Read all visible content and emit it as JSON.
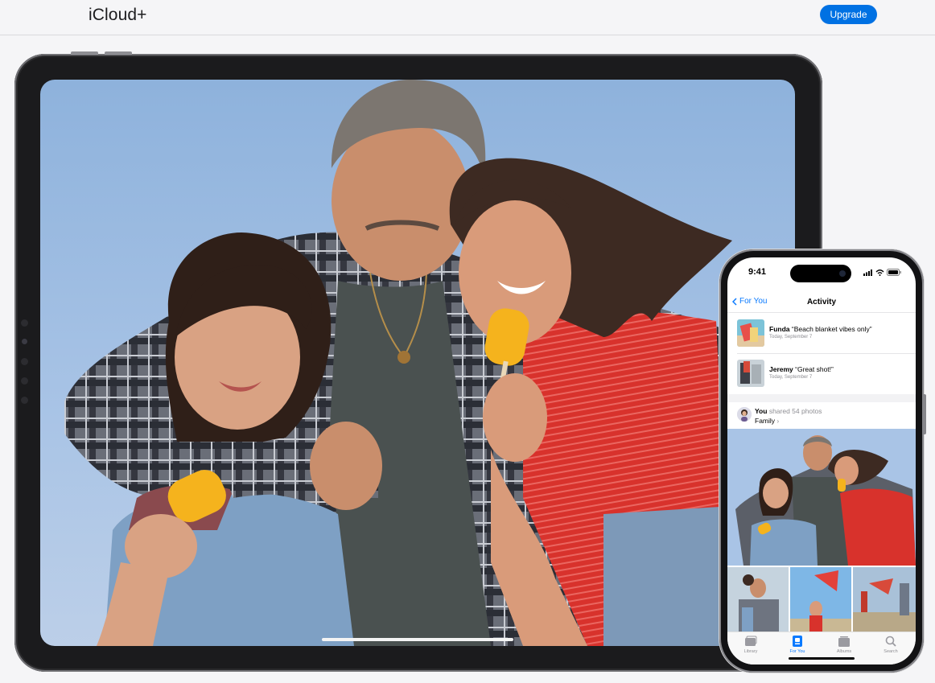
{
  "header": {
    "title": "iCloud+",
    "upgrade_label": "Upgrade"
  },
  "phone": {
    "status_time": "9:41",
    "back_label": "For You",
    "nav_title": "Activity",
    "activity": [
      {
        "name": "Funda",
        "comment": "“Beach blanket vibes only”",
        "time": "Today, September 7"
      },
      {
        "name": "Jeremy",
        "comment": "“Great shot!”",
        "time": "Today, September 7"
      }
    ],
    "shared": {
      "who": "You",
      "action": "shared 54 photos",
      "album": "Family",
      "chevron": "›"
    },
    "tabs": [
      {
        "label": "Library",
        "icon": "photo-library-icon",
        "active": false
      },
      {
        "label": "For You",
        "icon": "for-you-icon",
        "active": true
      },
      {
        "label": "Albums",
        "icon": "albums-icon",
        "active": false
      },
      {
        "label": "Search",
        "icon": "search-icon",
        "active": false
      }
    ]
  },
  "colors": {
    "accent": "#0071e3",
    "ios_blue": "#0a7aff",
    "page_bg": "#f5f5f7"
  }
}
